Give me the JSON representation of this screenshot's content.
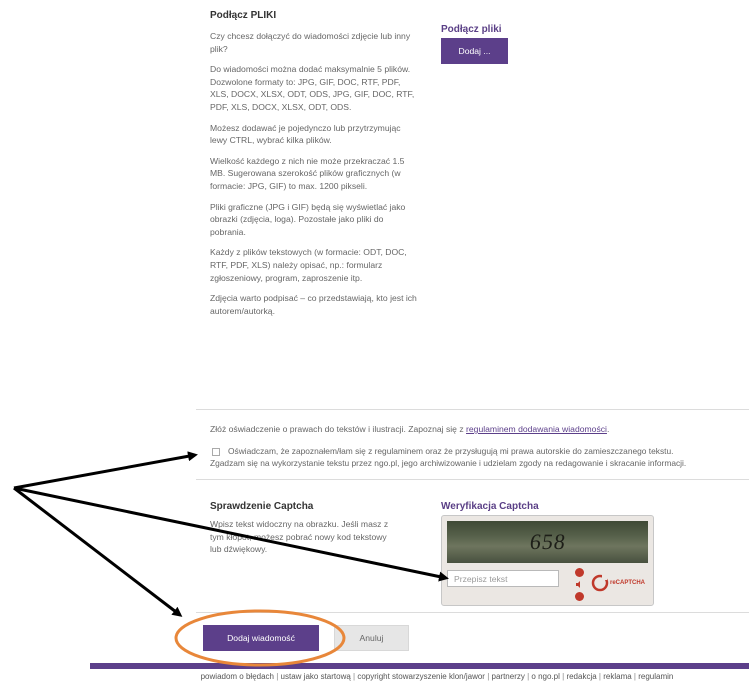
{
  "files": {
    "title": "Podłącz PLIKI",
    "paragraphs": [
      "Czy chcesz dołączyć do wiadomości zdjęcie lub inny plik?",
      "Do wiadomości można dodać maksymalnie 5 plików. Dozwolone formaty to: JPG, GIF, DOC, RTF, PDF, XLS, DOCX, XLSX, ODT, ODS, JPG, GIF, DOC, RTF, PDF, XLS, DOCX, XLSX, ODT, ODS.",
      "Możesz dodawać je pojedynczo lub przytrzymując lewy CTRL, wybrać kilka plików.",
      "Wielkość każdego z nich nie może przekraczać 1.5 MB. Sugerowana szerokość plików graficznych (w formacie: JPG, GIF) to max. 1200 pikseli.",
      "Pliki graficzne (JPG i GIF) będą się wyświetlać jako obrazki (zdjęcia, loga). Pozostałe jako pliki do pobrania.",
      "Każdy z plików tekstowych (w formacie: ODT, DOC, RTF, PDF, XLS) należy opisać, np.: formularz zgłoszeniowy, program, zaproszenie itp.",
      "Zdjęcia warto podpisać – co przedstawiają, kto jest ich autorem/autorką."
    ],
    "right_title": "Podłącz pliki",
    "add_button": "Dodaj ..."
  },
  "rights": {
    "intro_prefix": "Złóż oświadczenie o prawach do tekstów i ilustracji. Zapoznaj się z ",
    "intro_link": "regulaminem dodawania wiadomości",
    "intro_suffix": ".",
    "checkbox_checked": false,
    "declaration_line1": "Oświadczam, że zapoznałem/łam się z regulaminem oraz że przysługują mi prawa autorskie do zamieszczanego tekstu.",
    "declaration_line2": "Zgadzam się na wykorzystanie tekstu przez ngo.pl, jego archiwizowanie i udzielam zgody na redagowanie i skracanie informacji."
  },
  "captcha": {
    "title": "Sprawdzenie Captcha",
    "desc_lines": [
      "Wpisz tekst widoczny na obrazku. Jeśli masz z",
      "tym kłopot, możesz pobrać nowy kod tekstowy",
      "lub dźwiękowy."
    ],
    "right_title": "Weryfikacja Captcha",
    "image_text": "658",
    "input_placeholder": "Przepisz tekst",
    "logo_text": "reCAPTCHA"
  },
  "actions": {
    "submit": "Dodaj wiadomość",
    "cancel": "Anuluj"
  },
  "footer": {
    "links": [
      "powiadom o błędach",
      "ustaw jako startową",
      "copyright stowarzyszenie klon/jawor",
      "partnerzy",
      "o ngo.pl",
      "redakcja",
      "reklama",
      "regulamin"
    ]
  },
  "annotations": {
    "arrow_color": "#000000",
    "circle_color": "#e8873a"
  }
}
